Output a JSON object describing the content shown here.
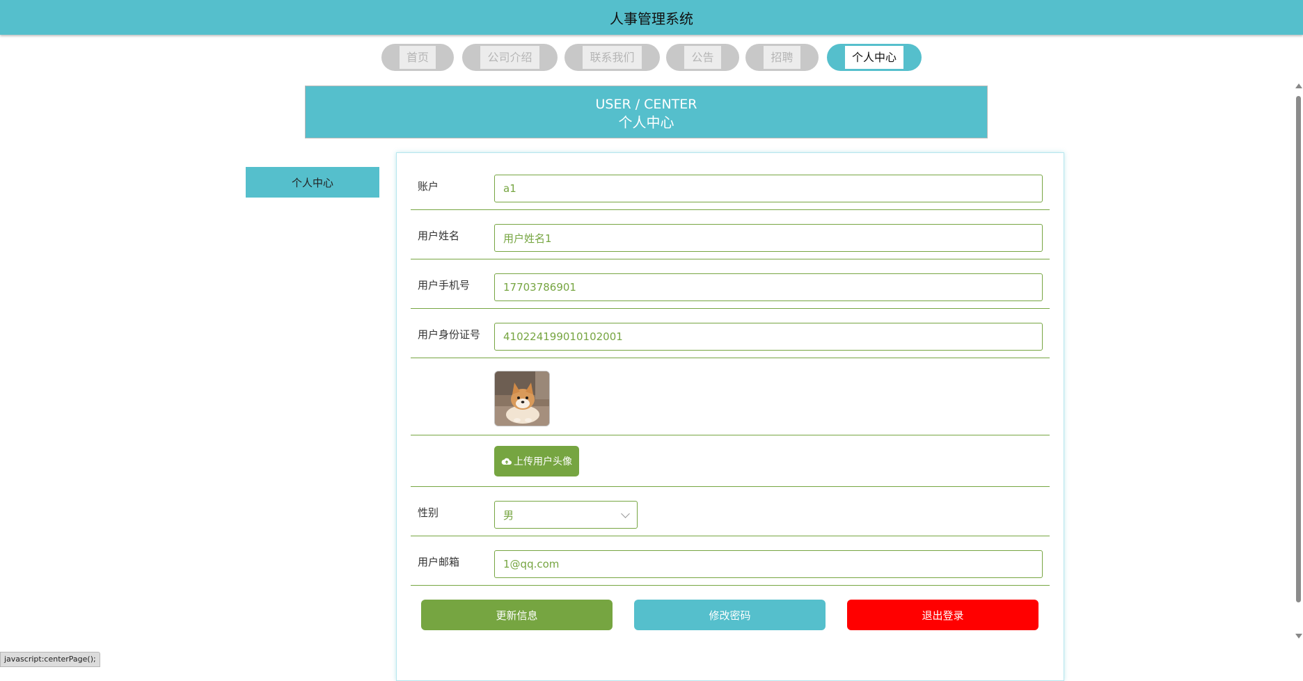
{
  "app": {
    "title": "人事管理系统"
  },
  "nav": {
    "items": [
      {
        "label": "首页"
      },
      {
        "label": "公司介绍"
      },
      {
        "label": "联系我们"
      },
      {
        "label": "公告"
      },
      {
        "label": "招聘"
      },
      {
        "label": "个人中心",
        "active": true
      }
    ]
  },
  "banner": {
    "title_en": "USER / CENTER",
    "title_zh": "个人中心"
  },
  "sidebar": {
    "items": [
      {
        "label": "个人中心"
      }
    ]
  },
  "form": {
    "account": {
      "label": "账户",
      "value": "a1"
    },
    "name": {
      "label": "用户姓名",
      "value": "用户姓名1"
    },
    "phone": {
      "label": "用户手机号",
      "value": "17703786901"
    },
    "id_card": {
      "label": "用户身份证号",
      "value": "410224199010102001"
    },
    "avatar": {
      "alt": "用户头像"
    },
    "upload_label": "上传用户头像",
    "gender": {
      "label": "性别",
      "value": "男"
    },
    "email": {
      "label": "用户邮箱",
      "value": "1@qq.com"
    }
  },
  "actions": {
    "update_label": "更新信息",
    "password_label": "修改密码",
    "logout_label": "退出登录"
  },
  "status_bar": {
    "text": "javascript:centerPage();"
  },
  "colors": {
    "primary": "#55bfcc",
    "green": "#76a541",
    "danger": "#ff0000",
    "nav_inactive": "#c8c8c8"
  },
  "icons": {
    "upload": "cloud-upload-icon",
    "select": "chevron-down-icon"
  }
}
